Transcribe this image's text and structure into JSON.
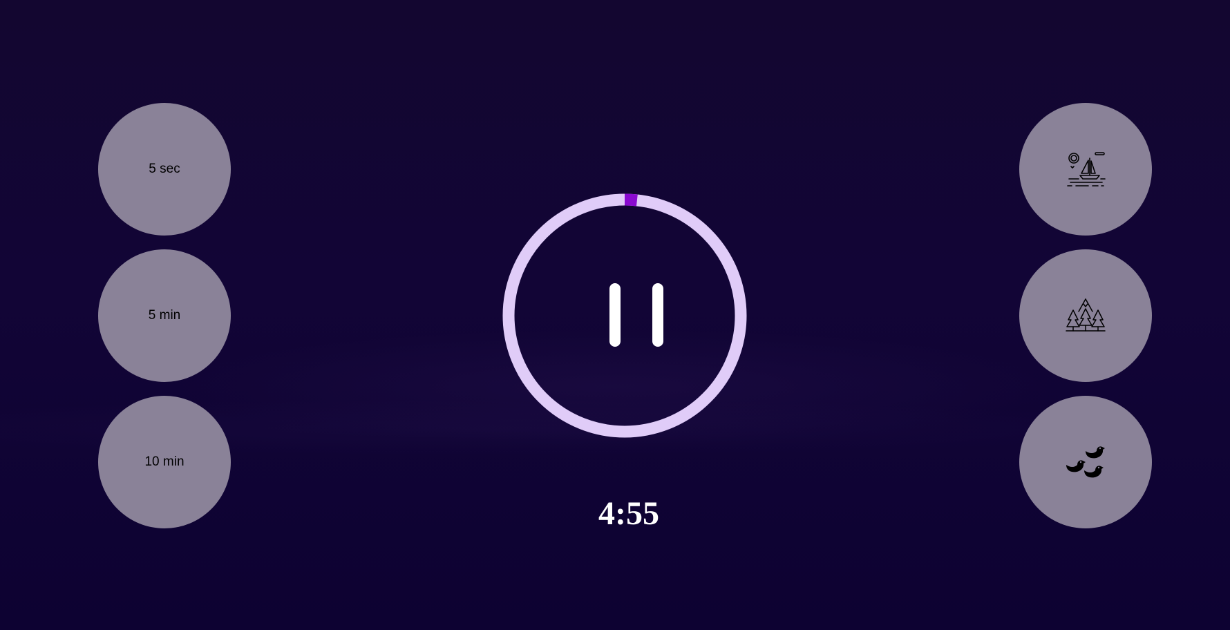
{
  "timer": {
    "remaining": "4:55",
    "progress_fraction": 0.017
  },
  "time_options": [
    {
      "label": "5 sec"
    },
    {
      "label": "5 min"
    },
    {
      "label": "10 min"
    }
  ],
  "sound_options": [
    {
      "icon": "sailboat-beach-icon"
    },
    {
      "icon": "forest-mountain-icon"
    },
    {
      "icon": "birds-icon"
    }
  ],
  "colors": {
    "background": "#120535",
    "ring_track": "#e0ccf8",
    "ring_progress": "#8a0ad0",
    "button_fill": "#8a8298",
    "timer_text": "#ffffff"
  }
}
